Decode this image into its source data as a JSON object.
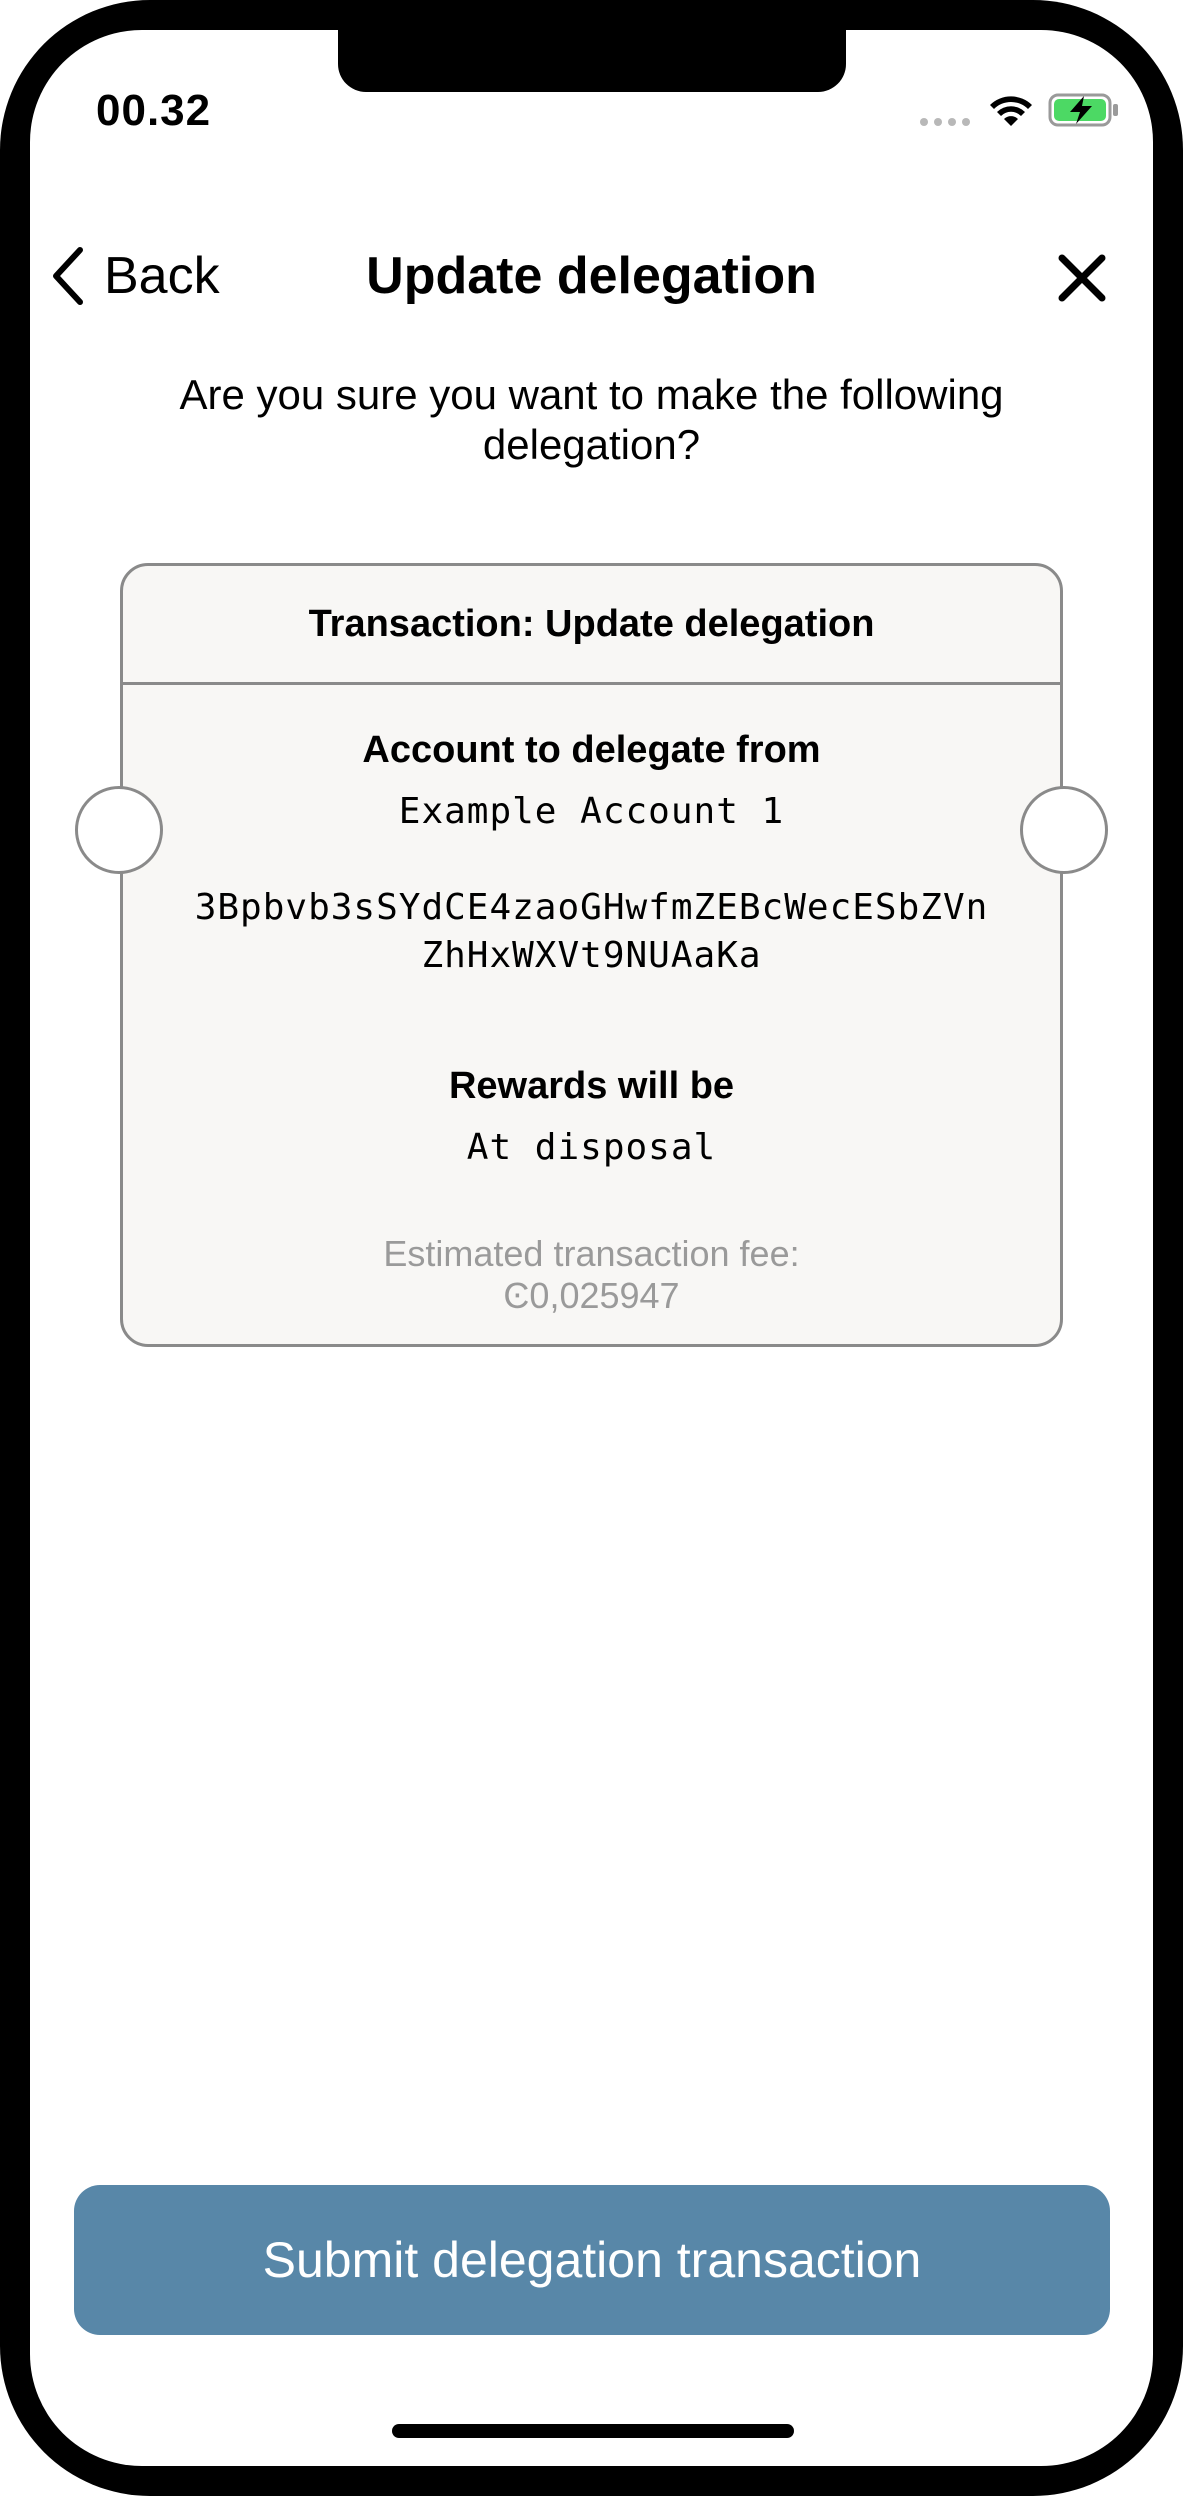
{
  "status_bar": {
    "time": "00.32"
  },
  "nav": {
    "back_label": "Back",
    "title": "Update delegation"
  },
  "question": "Are you sure you want to make the following delegation?",
  "transaction": {
    "header": "Transaction: Update delegation",
    "account_label": "Account to delegate from",
    "account_name": "Example Account 1",
    "address_line1": "3Bpbvb3sSYdCE4zaoGHwfmZEBcWecESbZVn",
    "address_line2": "ZhHxWXVt9NUAaKa",
    "rewards_label": "Rewards will be",
    "rewards_value": "At disposal",
    "fee_label": "Estimated transaction fee:",
    "fee_value": "Ͼ0,025947"
  },
  "submit_label": "Submit delegation transaction",
  "colors": {
    "primary_button": "#5887a8",
    "card_background": "#f8f7f5",
    "card_border": "#8a8a8a",
    "muted_text": "#9a9a9a",
    "battery_charge": "#4cd964"
  }
}
